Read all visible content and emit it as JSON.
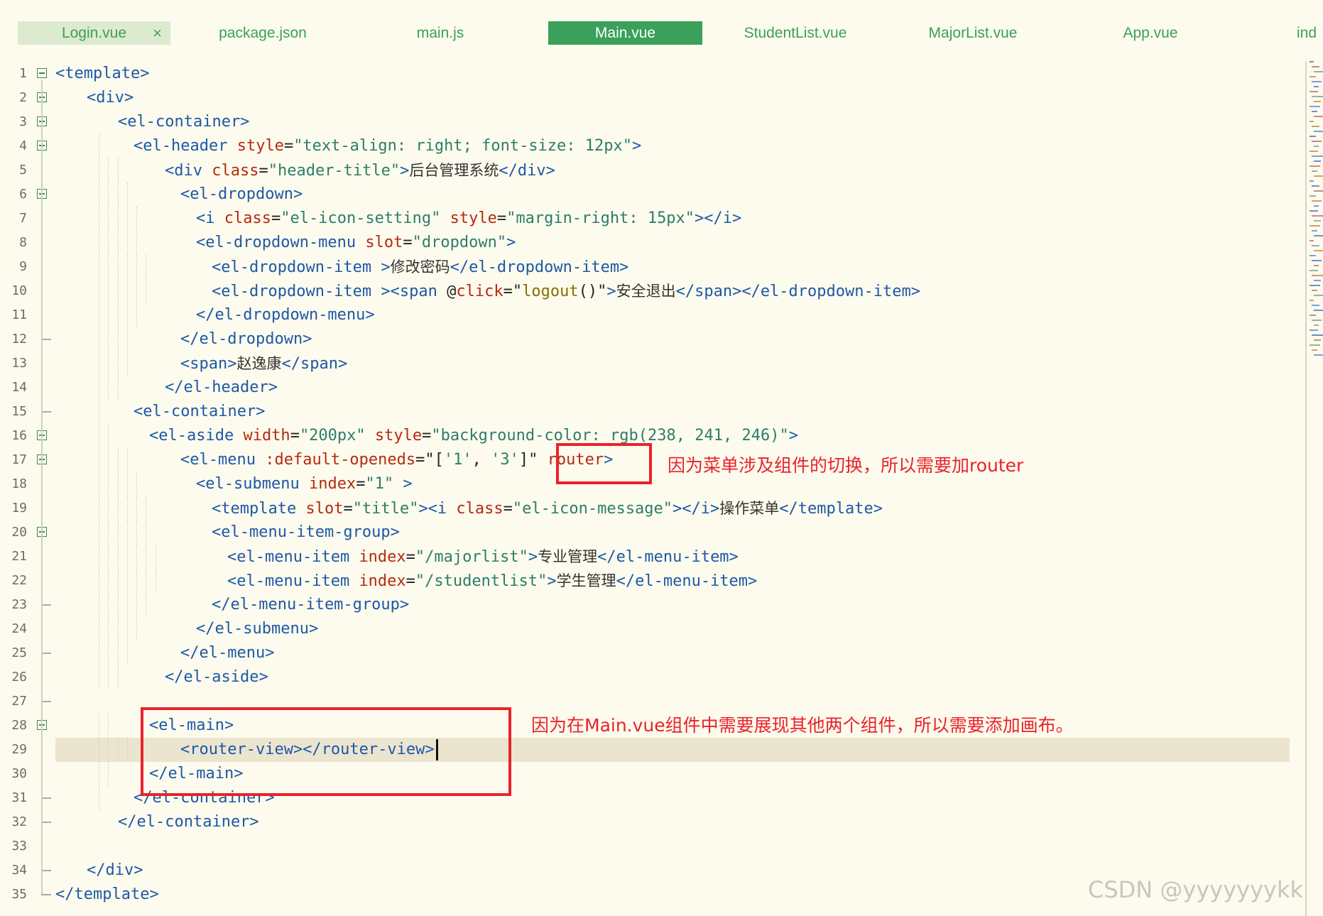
{
  "tabs": [
    {
      "label": "Login.vue",
      "closable": true
    },
    {
      "label": "package.json"
    },
    {
      "label": "main.js"
    },
    {
      "label": "Main.vue",
      "active": true
    },
    {
      "label": "StudentList.vue"
    },
    {
      "label": "MajorList.vue"
    },
    {
      "label": "App.vue"
    },
    {
      "label": "ind"
    }
  ],
  "close_glyph": "×",
  "annotations": {
    "router_note": "因为菜单涉及组件的切换，所以需要加router",
    "main_note": "因为在Main.vue组件中需要展现其他两个组件，所以需要添加画布。"
  },
  "watermark": "CSDN @yyyyyyykk",
  "code_lines": [
    {
      "n": "1",
      "fold": "open",
      "indent": 0,
      "t": [
        [
          "tg",
          "<template>"
        ]
      ]
    },
    {
      "n": "2",
      "fold": "open",
      "indent": 4,
      "t": [
        [
          "tg",
          "<div>"
        ]
      ]
    },
    {
      "n": "3",
      "fold": "open",
      "indent": 8,
      "t": [
        [
          "tg",
          "<el-container>"
        ]
      ]
    },
    {
      "n": "4",
      "fold": "open",
      "indent": 10,
      "t": [
        [
          "tg",
          "<el-header "
        ],
        [
          "at",
          "style"
        ],
        [
          "pl",
          "="
        ],
        [
          "st",
          "\"text-align: right; font-size: 12px\""
        ],
        [
          "tg",
          ">"
        ]
      ]
    },
    {
      "n": "5",
      "indent": 14,
      "t": [
        [
          "tg",
          "<div "
        ],
        [
          "at",
          "class"
        ],
        [
          "pl",
          "="
        ],
        [
          "st",
          "\"header-title\""
        ],
        [
          "tg",
          ">"
        ],
        [
          "cn",
          "后台管理系统"
        ],
        [
          "tg",
          "</div>"
        ]
      ]
    },
    {
      "n": "6",
      "fold": "open",
      "indent": 16,
      "t": [
        [
          "tg",
          "<el-dropdown>"
        ]
      ]
    },
    {
      "n": "7",
      "indent": 18,
      "t": [
        [
          "tg",
          "<i "
        ],
        [
          "at",
          "class"
        ],
        [
          "pl",
          "="
        ],
        [
          "st",
          "\"el-icon-setting\""
        ],
        [
          "pl",
          " "
        ],
        [
          "at",
          "style"
        ],
        [
          "pl",
          "="
        ],
        [
          "st",
          "\"margin-right: 15px\""
        ],
        [
          "tg",
          "></i>"
        ]
      ]
    },
    {
      "n": "8",
      "indent": 18,
      "t": [
        [
          "tg",
          "<el-dropdown-menu "
        ],
        [
          "at",
          "slot"
        ],
        [
          "pl",
          "="
        ],
        [
          "st",
          "\"dropdown\""
        ],
        [
          "tg",
          ">"
        ]
      ]
    },
    {
      "n": "9",
      "indent": 20,
      "t": [
        [
          "tg",
          "<el-dropdown-item >"
        ],
        [
          "cn",
          "修改密码"
        ],
        [
          "tg",
          "</el-dropdown-item>"
        ]
      ]
    },
    {
      "n": "10",
      "indent": 20,
      "t": [
        [
          "tg",
          "<el-dropdown-item ><span "
        ],
        [
          "pl",
          "@"
        ],
        [
          "at",
          "click"
        ],
        [
          "pl",
          "=\""
        ],
        [
          "fn",
          "logout"
        ],
        [
          "pl",
          "()\""
        ],
        [
          "tg",
          ">"
        ],
        [
          "cn",
          "安全退出"
        ],
        [
          "tg",
          "</span></el-dropdown-item>"
        ]
      ]
    },
    {
      "n": "11",
      "indent": 18,
      "t": [
        [
          "tg",
          "</el-dropdown-menu>"
        ]
      ]
    },
    {
      "n": "12",
      "fold": "end",
      "indent": 16,
      "t": [
        [
          "tg",
          "</el-dropdown>"
        ]
      ]
    },
    {
      "n": "13",
      "indent": 16,
      "t": [
        [
          "tg",
          "<span>"
        ],
        [
          "cn",
          "赵逸康"
        ],
        [
          "tg",
          "</span>"
        ]
      ]
    },
    {
      "n": "14",
      "indent": 14,
      "t": [
        [
          "tg",
          "</el-header>"
        ]
      ]
    },
    {
      "n": "15",
      "fold": "end",
      "indent": 10,
      "t": [
        [
          "tg",
          "<el-container>"
        ]
      ]
    },
    {
      "n": "16",
      "fold": "open",
      "indent": 12,
      "t": [
        [
          "tg",
          "<el-aside "
        ],
        [
          "at",
          "width"
        ],
        [
          "pl",
          "="
        ],
        [
          "st",
          "\"200px\""
        ],
        [
          "pl",
          " "
        ],
        [
          "at",
          "style"
        ],
        [
          "pl",
          "="
        ],
        [
          "st",
          "\"background-color: rgb(238, 241, 246)\""
        ],
        [
          "tg",
          ">"
        ]
      ]
    },
    {
      "n": "17",
      "fold": "open",
      "indent": 16,
      "t": [
        [
          "tg",
          "<el-menu "
        ],
        [
          "at",
          ":default-openeds"
        ],
        [
          "pl",
          "=\"["
        ],
        [
          "st",
          "'1'"
        ],
        [
          "pl",
          ", "
        ],
        [
          "st",
          "'3'"
        ],
        [
          "pl",
          "]\" "
        ],
        [
          "at",
          "router"
        ],
        [
          "tg",
          ">"
        ]
      ]
    },
    {
      "n": "18",
      "indent": 18,
      "t": [
        [
          "tg",
          "<el-submenu "
        ],
        [
          "at",
          "index"
        ],
        [
          "pl",
          "="
        ],
        [
          "st",
          "\"1\""
        ],
        [
          "tg",
          " >"
        ]
      ]
    },
    {
      "n": "19",
      "indent": 20,
      "t": [
        [
          "tg",
          "<template "
        ],
        [
          "at",
          "slot"
        ],
        [
          "pl",
          "="
        ],
        [
          "st",
          "\"title\""
        ],
        [
          "tg",
          "><i "
        ],
        [
          "at",
          "class"
        ],
        [
          "pl",
          "="
        ],
        [
          "st",
          "\"el-icon-message\""
        ],
        [
          "tg",
          "></i>"
        ],
        [
          "cn",
          "操作菜单"
        ],
        [
          "tg",
          "</template>"
        ]
      ]
    },
    {
      "n": "20",
      "fold": "open",
      "indent": 20,
      "t": [
        [
          "tg",
          "<el-menu-item-group>"
        ]
      ]
    },
    {
      "n": "21",
      "indent": 22,
      "t": [
        [
          "tg",
          "<el-menu-item "
        ],
        [
          "at",
          "index"
        ],
        [
          "pl",
          "="
        ],
        [
          "st",
          "\"/majorlist\""
        ],
        [
          "tg",
          ">"
        ],
        [
          "cn",
          "专业管理"
        ],
        [
          "tg",
          "</el-menu-item>"
        ]
      ]
    },
    {
      "n": "22",
      "indent": 22,
      "t": [
        [
          "tg",
          "<el-menu-item "
        ],
        [
          "at",
          "index"
        ],
        [
          "pl",
          "="
        ],
        [
          "st",
          "\"/studentlist\""
        ],
        [
          "tg",
          ">"
        ],
        [
          "cn",
          "学生管理"
        ],
        [
          "tg",
          "</el-menu-item>"
        ]
      ]
    },
    {
      "n": "23",
      "fold": "end",
      "indent": 20,
      "t": [
        [
          "tg",
          "</el-menu-item-group>"
        ]
      ]
    },
    {
      "n": "24",
      "indent": 18,
      "t": [
        [
          "tg",
          "</el-submenu>"
        ]
      ]
    },
    {
      "n": "25",
      "fold": "end",
      "indent": 16,
      "t": [
        [
          "tg",
          "</el-menu>"
        ]
      ]
    },
    {
      "n": "26",
      "indent": 14,
      "t": [
        [
          "tg",
          "</el-aside>"
        ]
      ]
    },
    {
      "n": "27",
      "fold": "end",
      "indent": 0,
      "t": []
    },
    {
      "n": "28",
      "fold": "open",
      "indent": 12,
      "t": [
        [
          "tg",
          "<el-main>"
        ]
      ]
    },
    {
      "n": "29",
      "indent": 16,
      "current": true,
      "t": [
        [
          "tg",
          "<router-view></router-view>"
        ]
      ]
    },
    {
      "n": "30",
      "indent": 12,
      "t": [
        [
          "tg",
          "</el-main>"
        ]
      ]
    },
    {
      "n": "31",
      "fold": "end",
      "indent": 10,
      "t": [
        [
          "tg",
          "</el-container>"
        ]
      ]
    },
    {
      "n": "32",
      "fold": "end",
      "indent": 8,
      "t": [
        [
          "tg",
          "</el-container>"
        ]
      ]
    },
    {
      "n": "33",
      "indent": 0,
      "t": []
    },
    {
      "n": "34",
      "fold": "end",
      "indent": 4,
      "t": [
        [
          "tg",
          "</div>"
        ]
      ]
    },
    {
      "n": "35",
      "fold": "last",
      "indent": 0,
      "t": [
        [
          "tg",
          "</template>"
        ]
      ]
    }
  ]
}
